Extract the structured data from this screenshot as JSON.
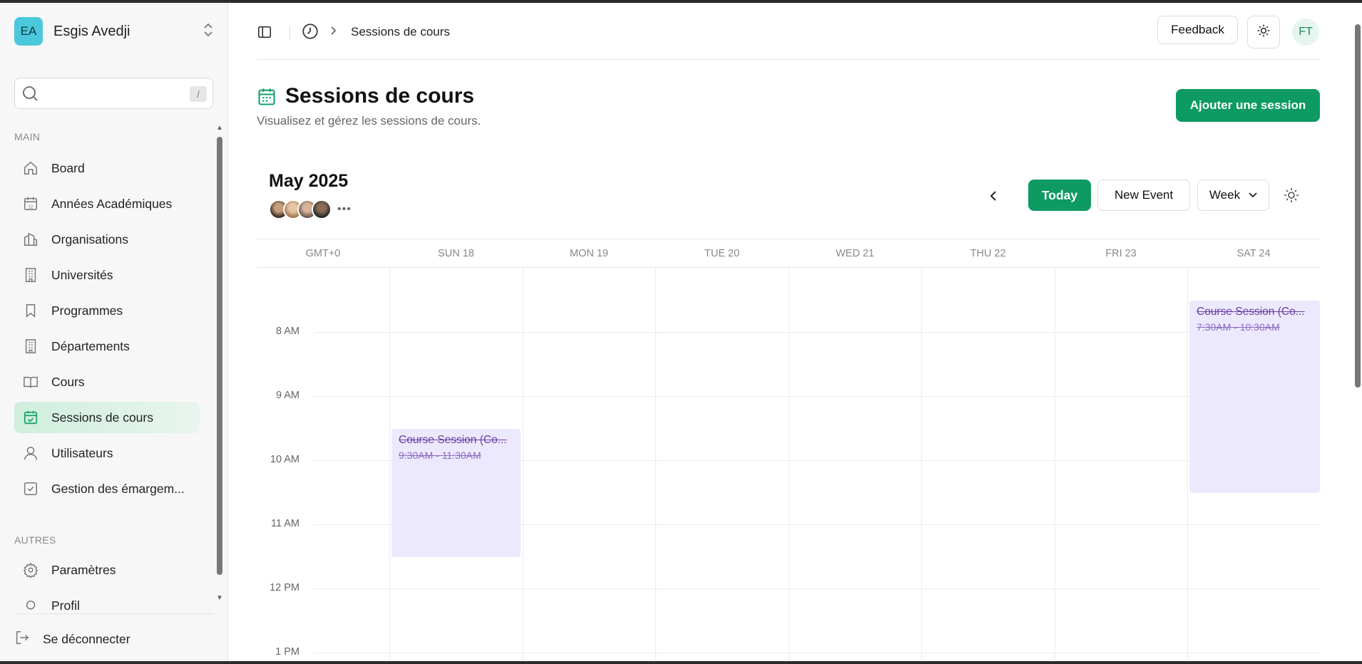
{
  "workspace": {
    "initials": "EA",
    "name": "Esgis Avedji"
  },
  "search": {
    "shortcut": "/"
  },
  "sidebar": {
    "main_label": "MAIN",
    "items": [
      {
        "label": "Board",
        "icon": "home-icon"
      },
      {
        "label": "Années Académiques",
        "icon": "calendar-12-icon"
      },
      {
        "label": "Organisations",
        "icon": "building-icon"
      },
      {
        "label": "Universités",
        "icon": "building-tall-icon"
      },
      {
        "label": "Programmes",
        "icon": "bookmark-icon"
      },
      {
        "label": "Départements",
        "icon": "building-tall-icon"
      },
      {
        "label": "Cours",
        "icon": "book-open-icon"
      },
      {
        "label": "Sessions de cours",
        "icon": "calendar-check-icon",
        "active": true
      },
      {
        "label": "Utilisateurs",
        "icon": "user-icon"
      },
      {
        "label": "Gestion des émargem...",
        "icon": "checkbox-icon"
      }
    ],
    "other_label": "AUTRES",
    "other_items": [
      {
        "label": "Paramètres",
        "icon": "gear-icon"
      },
      {
        "label": "Profil",
        "icon": "user-circle-icon"
      }
    ],
    "logout": "Se déconnecter"
  },
  "topbar": {
    "breadcrumb": "Sessions de cours",
    "feedback": "Feedback",
    "user_initials": "FT"
  },
  "page": {
    "title": "Sessions de cours",
    "subtitle": "Visualisez et gérez les sessions de cours.",
    "add_button": "Ajouter une session"
  },
  "calendar": {
    "month": "May 2025",
    "more": "•••",
    "today": "Today",
    "new_event": "New Event",
    "view": "Week",
    "timezone": "GMT+0",
    "days": [
      "SUN 18",
      "MON 19",
      "TUE 20",
      "WED 21",
      "THU 22",
      "FRI 23",
      "SAT 24"
    ],
    "hours": [
      "8 AM",
      "9 AM",
      "10 AM",
      "11 AM",
      "12 PM",
      "1 PM"
    ],
    "events": [
      {
        "title": "Course Session (Co...",
        "time": "9:30AM - 11:30AM",
        "day": "SUN 18"
      },
      {
        "title": "Course Session (Co...",
        "time": "7:30AM - 10:30AM",
        "day": "SAT 24"
      }
    ],
    "accent": "#0e9a63",
    "event_color": "#ece9ff"
  }
}
